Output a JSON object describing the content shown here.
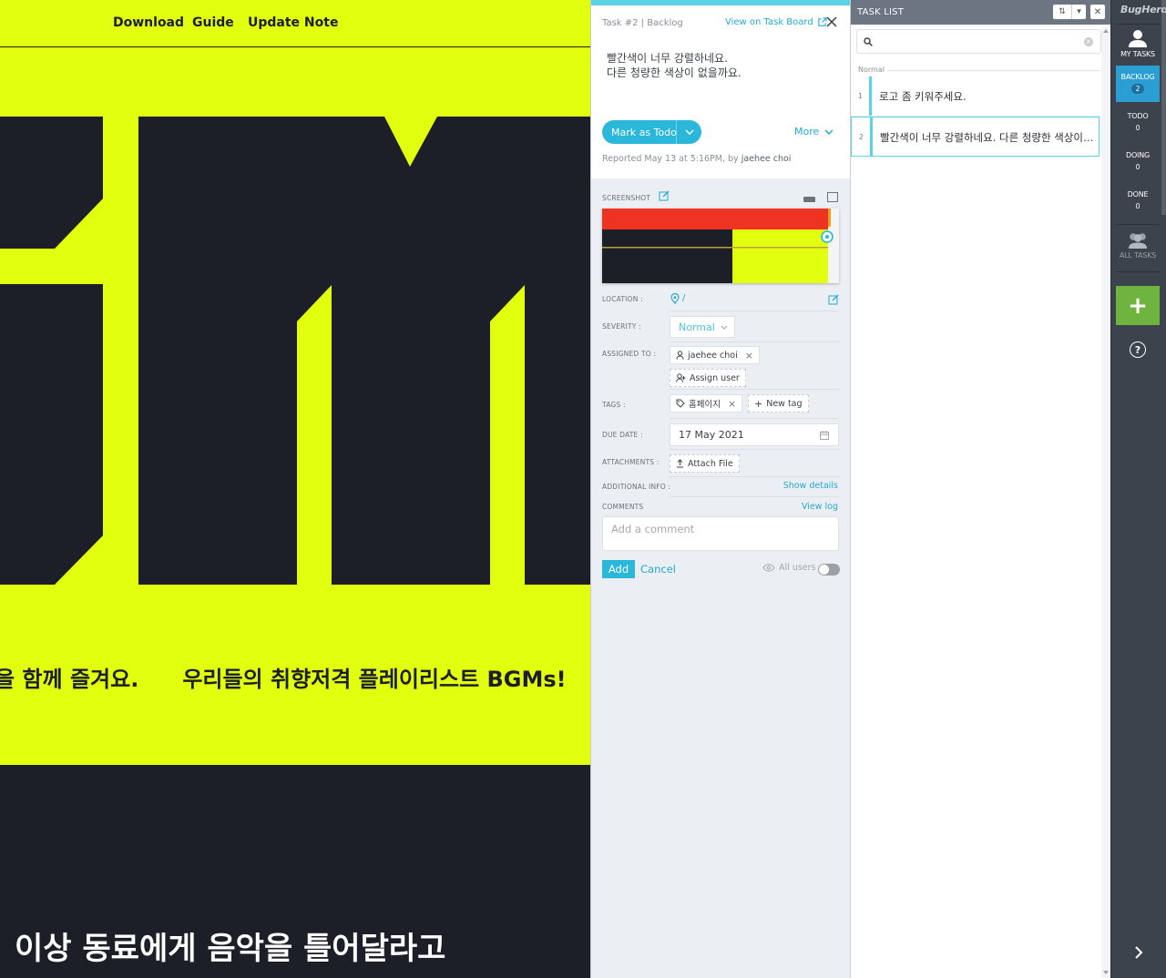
{
  "site": {
    "nav": [
      "Download",
      "Guide",
      "Update Note"
    ],
    "marquee_1": "을 함께 즐겨요.",
    "marquee_2": "우리들의 취향저격 플레이리스트 BGMs!",
    "bottom_text": "이상 동료에게 음악을 틀어달라고",
    "colors": {
      "lime": "#e2ff0f",
      "navy": "#1c1f28"
    }
  },
  "detail": {
    "task_id": "Task #2 | Backlog",
    "view_board": "View on Task Board",
    "description_line1": "빨간색이 너무 강렬하네요.",
    "description_line2": "다른 청량한 색상이 없을까요.",
    "mark_button": "Mark as Todo",
    "more": "More",
    "reported_prefix": "Reported May 13 at 5:16PM, by",
    "reporter": "jaehee choi",
    "labels": {
      "screenshot": "SCREENSHOT",
      "location": "LOCATION :",
      "severity": "SEVERITY :",
      "assigned": "ASSIGNED TO :",
      "tags": "TAGS :",
      "due": "DUE DATE :",
      "attachments": "ATTACHMENTS :",
      "additional": "ADDITIONAL INFO :",
      "comments": "COMMENTS"
    },
    "location_value": "/",
    "severity_value": "Normal",
    "assignee": "jaehee choi",
    "assign_user": "Assign user",
    "tag": "홈페이지",
    "new_tag": "New tag",
    "due_date": "17 May 2021",
    "attach_file": "Attach File",
    "show_details": "Show details",
    "view_log": "View log",
    "comment_placeholder": "Add a comment",
    "add_button": "Add",
    "cancel_button": "Cancel",
    "all_users": "All users",
    "all_users_toggle": false
  },
  "tasklist": {
    "title": "TASK LIST",
    "sort_icon": "sort-icon",
    "search_placeholder": "",
    "group": "Normal",
    "items": [
      {
        "num": "1",
        "text": "로고 좀 키워주세요."
      },
      {
        "num": "2",
        "text": "빨간색이 너무 강렬하네요. 다른 청량한 색상이 없을까요."
      }
    ],
    "selected_index": 1
  },
  "rail": {
    "logo": "BugHerd",
    "items": [
      {
        "label": "MY TASKS"
      },
      {
        "label": "BACKLOG",
        "count": "2"
      },
      {
        "label": "TODO",
        "count": "0"
      },
      {
        "label": "DOING",
        "count": "0"
      },
      {
        "label": "DONE",
        "count": "0"
      },
      {
        "label": "ALL TASKS"
      }
    ],
    "active": "BACKLOG",
    "add": "+",
    "help": "?",
    "accent": "#2b9fd4",
    "add_color": "#6eb43f"
  }
}
